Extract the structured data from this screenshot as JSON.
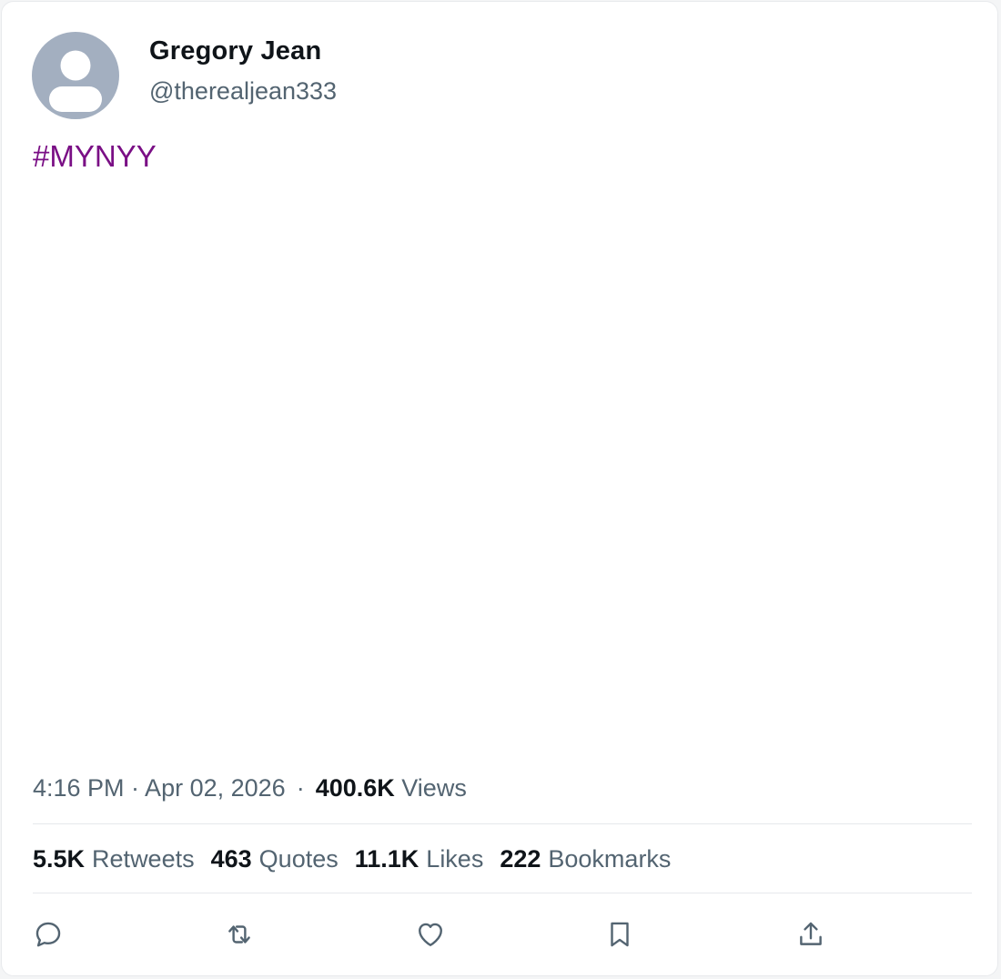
{
  "author": {
    "name": "Gregory Jean",
    "handle": "@therealjean333",
    "avatar_icon": "default-avatar-icon",
    "avatar_color": "#a3afc0"
  },
  "tweet": {
    "text": "#MYNYY",
    "text_color": "#7a0f85",
    "timestamp": "4:16 PM · Apr 02, 2026",
    "separator": "·",
    "views_count": "400.6K",
    "views_label": "Views"
  },
  "stats": [
    {
      "count": "5.5K",
      "label": "Retweets"
    },
    {
      "count": "463",
      "label": "Quotes"
    },
    {
      "count": "11.1K",
      "label": "Likes"
    },
    {
      "count": "222",
      "label": "Bookmarks"
    }
  ],
  "actions": [
    {
      "name": "reply",
      "icon": "reply-icon"
    },
    {
      "name": "retweet",
      "icon": "retweet-icon"
    },
    {
      "name": "like",
      "icon": "heart-icon"
    },
    {
      "name": "bookmark",
      "icon": "bookmark-icon"
    },
    {
      "name": "share",
      "icon": "share-icon"
    }
  ],
  "colors": {
    "primary_text": "#0f1419",
    "secondary_text": "#536471",
    "divider": "#e6e9ec"
  }
}
